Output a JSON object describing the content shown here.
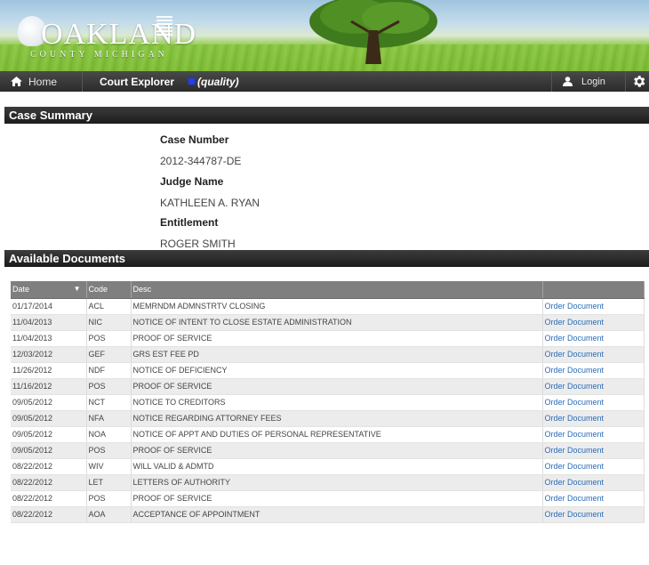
{
  "header": {
    "logo_word": "OAKLAND",
    "logo_sub": "COUNTY MICHIGAN"
  },
  "nav": {
    "home_label": "Home",
    "app_title": "Court Explorer",
    "env_badge": "(quality)",
    "login_label": "Login"
  },
  "case_summary": {
    "title": "Case Summary",
    "case_number_label": "Case Number",
    "case_number": "2012-344787-DE",
    "judge_label": "Judge Name",
    "judge": "KATHLEEN A. RYAN",
    "entitlement_label": "Entitlement",
    "entitlement": "ROGER SMITH"
  },
  "documents": {
    "title": "Available Documents",
    "columns": [
      "Date",
      "Code",
      "Desc",
      ""
    ],
    "rows": [
      {
        "date": "01/17/2014",
        "code": "ACL",
        "desc": "MEMRNDM ADMNSTRTV CLOSING",
        "action": "Order Document"
      },
      {
        "date": "11/04/2013",
        "code": "NIC",
        "desc": "NOTICE OF INTENT TO CLOSE ESTATE ADMINISTRATION",
        "action": "Order Document"
      },
      {
        "date": "11/04/2013",
        "code": "POS",
        "desc": "PROOF OF SERVICE",
        "action": "Order Document"
      },
      {
        "date": "12/03/2012",
        "code": "GEF",
        "desc": "GRS EST FEE PD",
        "action": "Order Document"
      },
      {
        "date": "11/26/2012",
        "code": "NDF",
        "desc": "NOTICE OF DEFICIENCY",
        "action": "Order Document"
      },
      {
        "date": "11/16/2012",
        "code": "POS",
        "desc": "PROOF OF SERVICE",
        "action": "Order Document"
      },
      {
        "date": "09/05/2012",
        "code": "NCT",
        "desc": "NOTICE TO CREDITORS",
        "action": "Order Document"
      },
      {
        "date": "09/05/2012",
        "code": "NFA",
        "desc": "NOTICE REGARDING ATTORNEY FEES",
        "action": "Order Document"
      },
      {
        "date": "09/05/2012",
        "code": "NOA",
        "desc": "NOTICE OF APPT AND DUTIES OF PERSONAL REPRESENTATIVE",
        "action": "Order Document"
      },
      {
        "date": "09/05/2012",
        "code": "POS",
        "desc": "PROOF OF SERVICE",
        "action": "Order Document"
      },
      {
        "date": "08/22/2012",
        "code": "WIV",
        "desc": "WILL VALID & ADMTD",
        "action": "Order Document"
      },
      {
        "date": "08/22/2012",
        "code": "LET",
        "desc": "LETTERS OF AUTHORITY",
        "action": "Order Document"
      },
      {
        "date": "08/22/2012",
        "code": "POS",
        "desc": "PROOF OF SERVICE",
        "action": "Order Document"
      },
      {
        "date": "08/22/2012",
        "code": "AOA",
        "desc": "ACCEPTANCE OF APPOINTMENT",
        "action": "Order Document"
      }
    ]
  },
  "colors": {
    "nav_bg": "#2b2b2b",
    "header_bar": "#1c1c1c",
    "table_header": "#7f7f7f",
    "link": "#2a6db8",
    "env_dot": "#1f3dff"
  },
  "icons": {
    "home": "home-icon",
    "login": "user-icon",
    "settings": "gear-icon",
    "sort": "sort-down-icon"
  }
}
